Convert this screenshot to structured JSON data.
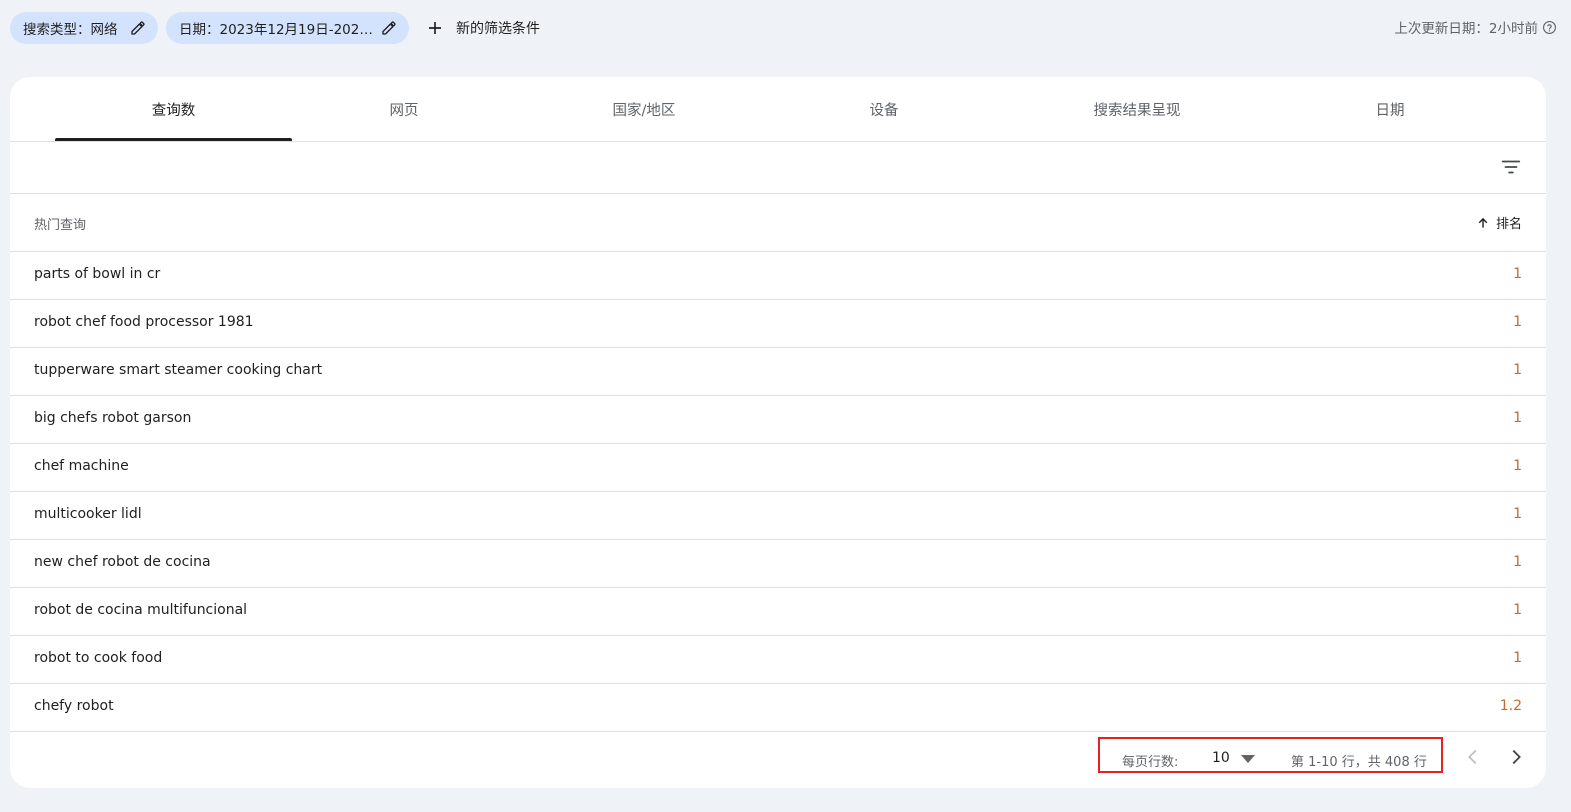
{
  "filters": {
    "chip1": "搜索类型：网络",
    "chip2": "日期：2023年12月19日-2024…",
    "add_label": "新的筛选条件",
    "updated": "上次更新日期：2小时前"
  },
  "tabs": [
    {
      "label": "查询数",
      "active": true
    },
    {
      "label": "网页"
    },
    {
      "label": "国家/地区"
    },
    {
      "label": "设备"
    },
    {
      "label": "搜索结果呈现"
    },
    {
      "label": "日期"
    }
  ],
  "table": {
    "header_query": "热门查询",
    "header_rank": "排名",
    "rows": [
      {
        "query": "parts of bowl in cr",
        "rank": "1"
      },
      {
        "query": "robot chef food processor 1981",
        "rank": "1"
      },
      {
        "query": "tupperware smart steamer cooking chart",
        "rank": "1"
      },
      {
        "query": "big chefs robot garson",
        "rank": "1"
      },
      {
        "query": "chef machine",
        "rank": "1"
      },
      {
        "query": "multicooker lidl",
        "rank": "1"
      },
      {
        "query": "new chef robot de cocina",
        "rank": "1"
      },
      {
        "query": "robot de cocina multifuncional",
        "rank": "1"
      },
      {
        "query": "robot to cook food",
        "rank": "1"
      },
      {
        "query": "chefy robot",
        "rank": "1.2"
      }
    ]
  },
  "pager": {
    "rows_per_page_label": "每页行数:",
    "rows_per_page": "10",
    "range_text": "第 1-10 行，共 408 行"
  },
  "colors": {
    "chip_bg": "#d3e3fd",
    "rank_value": "#c5692b",
    "highlight": "#e52222",
    "page_bg": "#eff3f8"
  }
}
